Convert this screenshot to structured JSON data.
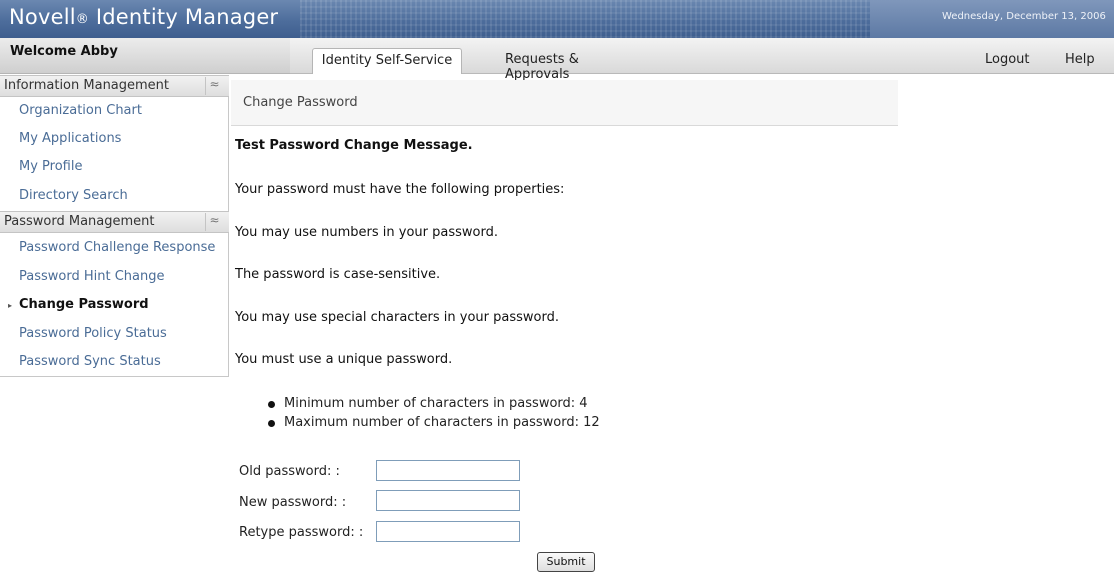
{
  "banner": {
    "brand_name": "Novell",
    "brand_reg": "®",
    "brand_product": " Identity Manager",
    "date": "Wednesday, December 13, 2006"
  },
  "tabbar": {
    "welcome": "Welcome Abby",
    "tabs": [
      {
        "label": "Identity Self-Service",
        "active": true
      },
      {
        "label": "Requests & Approvals",
        "active": false
      }
    ],
    "logout": "Logout",
    "help": "Help"
  },
  "sidebar": {
    "sections": [
      {
        "title": "Information Management",
        "items": [
          "Organization Chart",
          "My Applications",
          "My Profile",
          "Directory Search"
        ]
      },
      {
        "title": "Password Management",
        "items": [
          "Password Challenge Response",
          "Password Hint Change",
          "Change Password",
          "Password Policy Status",
          "Password Sync Status"
        ],
        "current": "Change Password"
      }
    ],
    "collapse_glyph": "≈"
  },
  "main": {
    "page_title": "Change Password",
    "messages": [
      "Test Password Change Message.",
      "Your password must have the following properties:",
      "You may use numbers in your password.",
      "The password is case-sensitive.",
      "You may use special characters in your password.",
      "You must use a unique password."
    ],
    "bullets": [
      "Minimum number of characters in password: 4",
      "Maximum number of characters in password: 12"
    ],
    "form": {
      "old_label": "Old password: :",
      "new_label": "New password: :",
      "retype_label": "Retype password: :",
      "old_value": "",
      "new_value": "",
      "retype_value": "",
      "submit": "Submit"
    }
  },
  "colors": {
    "banner": "#4d6d9c",
    "nav_link": "#4a6c96",
    "input_border": "#7f9db9"
  }
}
